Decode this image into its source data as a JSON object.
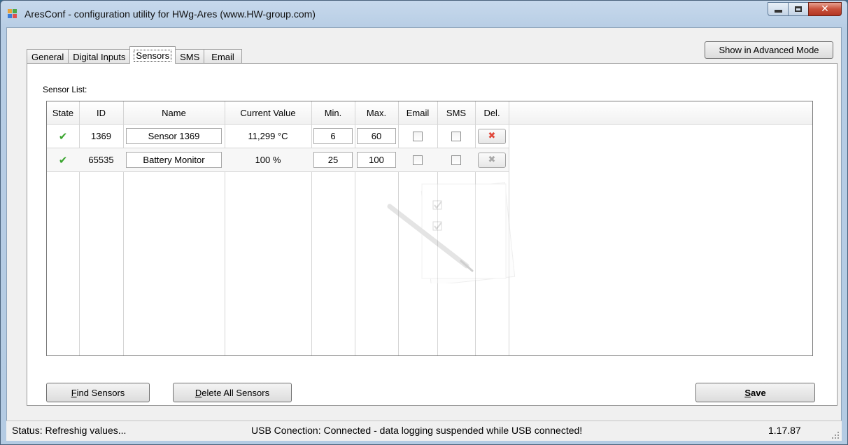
{
  "window": {
    "title": "AresConf - configuration utility for HWg-Ares (www.HW-group.com)"
  },
  "tabs": [
    {
      "label": "General"
    },
    {
      "label": "Digital Inputs"
    },
    {
      "label": "Sensors",
      "active": true
    },
    {
      "label": "SMS"
    },
    {
      "label": "Email"
    }
  ],
  "advanced_button": "Show in Advanced Mode",
  "sensor_list_label": "Sensor List:",
  "table": {
    "columns": [
      "State",
      "ID",
      "Name",
      "Current Value",
      "Min.",
      "Max.",
      "Email",
      "SMS",
      "Del."
    ],
    "rows": [
      {
        "state_icon": "check-icon",
        "id": "1369",
        "name": "Sensor 1369",
        "current_value": "11,299 °C",
        "min": "6",
        "max": "60",
        "email": false,
        "sms": false,
        "del_icon": "delete-x-icon-active"
      },
      {
        "state_icon": "check-icon",
        "id": "65535",
        "name": "Battery Monitor",
        "current_value": "100 %",
        "min": "25",
        "max": "100",
        "email": false,
        "sms": false,
        "del_icon": "delete-x-icon-disabled"
      }
    ]
  },
  "buttons": {
    "find_sensors": {
      "accel": "F",
      "rest": "ind Sensors"
    },
    "delete_all": {
      "accel": "D",
      "rest": "elete All Sensors"
    },
    "save": {
      "accel": "S",
      "rest": "ave"
    }
  },
  "status": {
    "status_text": "Status:  Refreshig values...",
    "usb_text": "USB Conection:  Connected - data logging suspended while USB connected!",
    "version": "1.17.87"
  },
  "colors": {
    "check": "#3aa52f",
    "delete_active": "#e0473a",
    "delete_disabled": "#a8a8a8"
  }
}
